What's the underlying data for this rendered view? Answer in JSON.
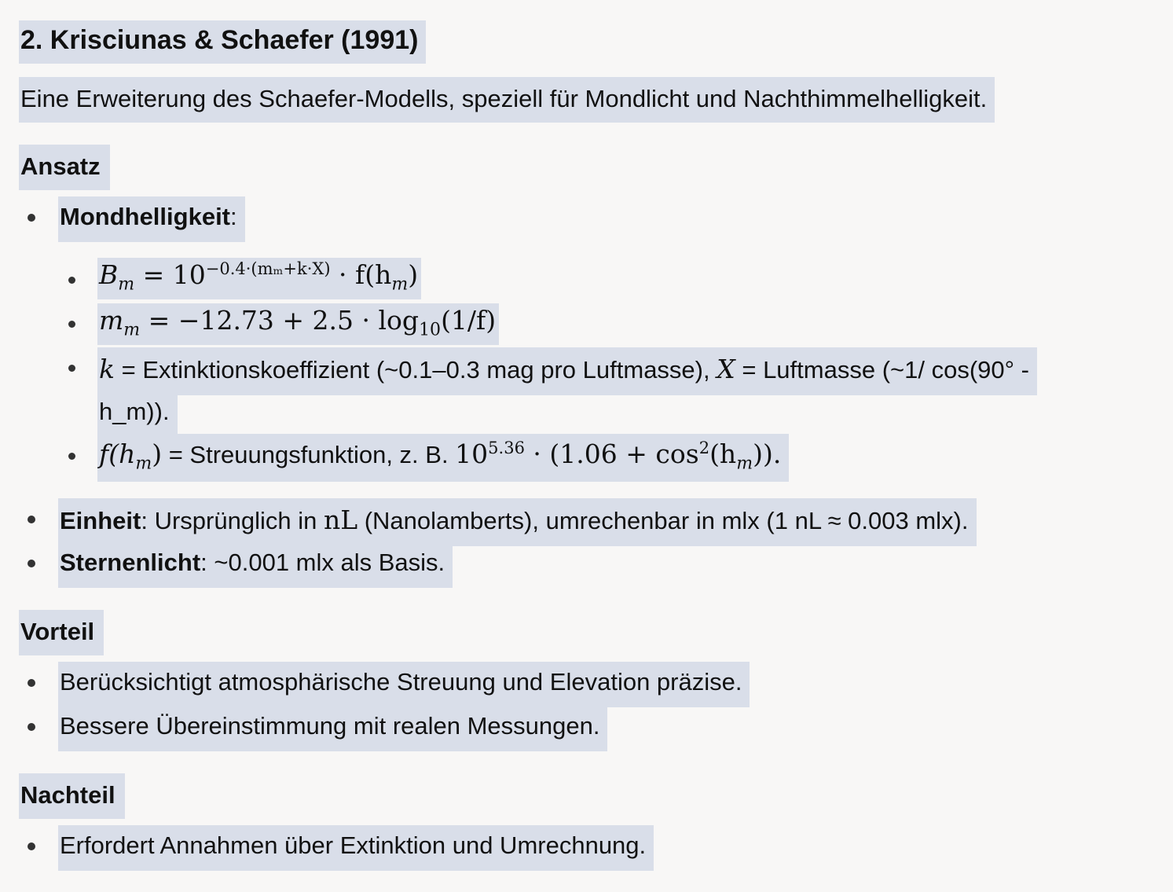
{
  "heading": "2. Krisciunas & Schaefer (1991)",
  "intro": "Eine Erweiterung des Schaefer-Modells, speziell für Mondlicht und Nachthimmelhelligkeit.",
  "ansatz": {
    "title": "Ansatz",
    "moon_label": "Mondhelligkeit",
    "moon_colon": ":",
    "formulas": {
      "f1_lhs": "B",
      "f1_lhs_sub": "m",
      "f1_eq": " = 10",
      "f1_exp": "−0.4·(mₘ+k·X)",
      "f1_rest": " · f(h",
      "f1_rest_sub": "m",
      "f1_close": ")",
      "f2_lhs": "m",
      "f2_lhs_sub": "m",
      "f2_mid": " = −12.73 + 2.5 · log",
      "f2_sub": "10",
      "f2_tail": "(1/f)",
      "k_sym": "k",
      "k_text": " = Extinktionskoeffizient (~0.1–0.3 mag pro Luftmasse), ",
      "x_sym": "X",
      "x_text": " = Luftmasse (~1/ cos(90° -",
      "x_cont": "h_m)).",
      "f_sym": "f(h",
      "f_sym_sub": "m",
      "f_sym_close": ")",
      "f_text": " = Streuungsfunktion, z. B. ",
      "f_base": "10",
      "f_exp": "5.36",
      "f_tail_a": " · (1.06 + cos",
      "f_tail_sup": "2",
      "f_tail_b": "(h",
      "f_tail_sub": "m",
      "f_tail_c": ")).",
      "dot": "."
    },
    "unit_label": "Einheit",
    "unit_text_a": ": Ursprünglich in ",
    "unit_math": "nL",
    "unit_text_b": " (Nanolamberts), umrechenbar in mlx (1 nL ≈ 0.003 mlx).",
    "star_label": "Sternenlicht",
    "star_text": ": ~0.001 mlx als Basis."
  },
  "vorteil": {
    "title": "Vorteil",
    "items": [
      "Berücksichtigt atmosphärische Streuung und Elevation präzise.",
      "Bessere Übereinstimmung mit realen Messungen."
    ]
  },
  "nachteil": {
    "title": "Nachteil",
    "items": [
      "Erfordert Annahmen über Extinktion und Umrechnung."
    ]
  }
}
